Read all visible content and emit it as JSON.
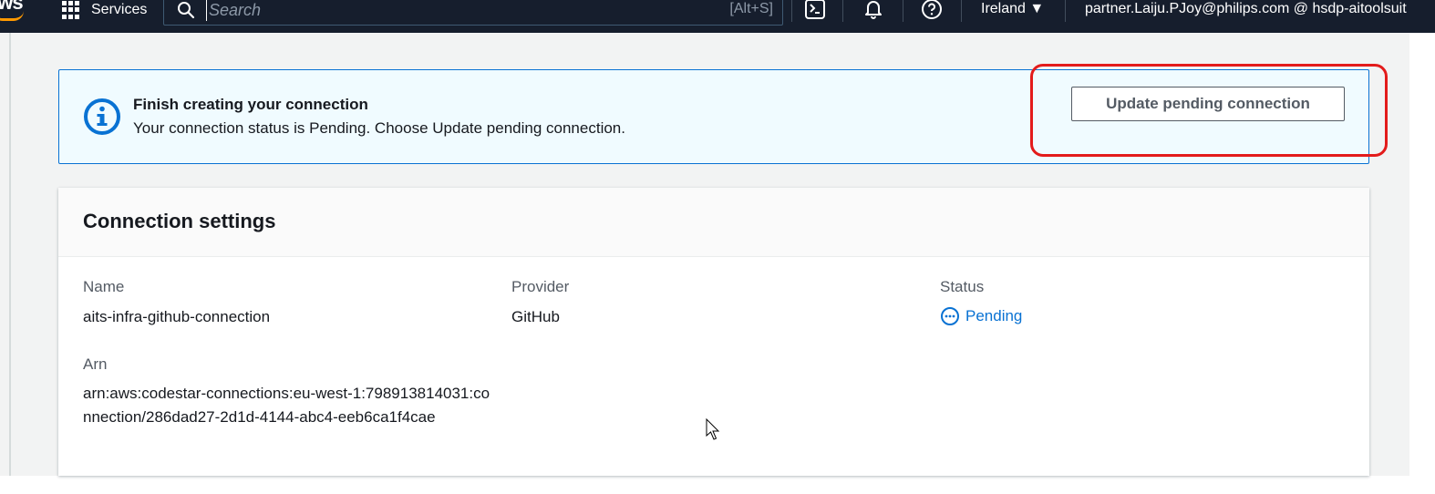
{
  "nav": {
    "logo_text": "aws",
    "services_label": "Services",
    "search_placeholder": "Search",
    "search_shortcut": "[Alt+S]",
    "region": "Ireland ▼",
    "account": "partner.Laiju.PJoy@philips.com @ hsdp-aitoolsuit"
  },
  "alert": {
    "title": "Finish creating your connection",
    "body": "Your connection status is Pending. Choose Update pending connection.",
    "button_label": "Update pending connection",
    "icon": "info-icon"
  },
  "panel": {
    "title": "Connection settings",
    "fields": {
      "name_label": "Name",
      "name_value": "aits-infra-github-connection",
      "provider_label": "Provider",
      "provider_value": "GitHub",
      "status_label": "Status",
      "status_value": "Pending",
      "arn_label": "Arn",
      "arn_value": "arn:aws:codestar-connections:eu-west-1:798913814031:connection/286dad27-2d1d-4144-abc4-eeb6ca1f4cae"
    }
  },
  "colors": {
    "nav_bg": "#161e2d",
    "accent_blue": "#0972d3",
    "alert_bg": "#f0fbff",
    "highlight_red": "#e31b1b"
  }
}
